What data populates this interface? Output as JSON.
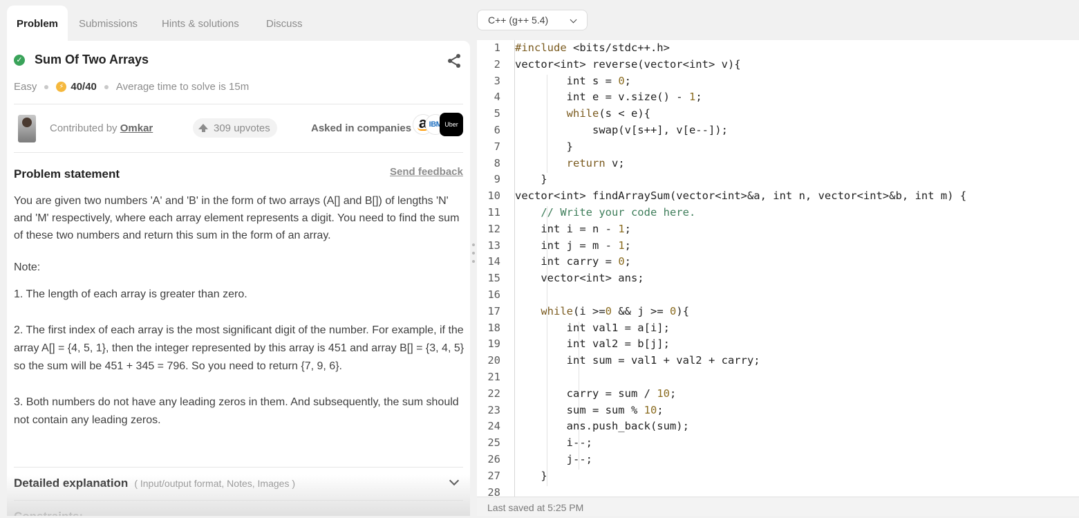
{
  "tabs": [
    {
      "label": "Problem",
      "active": true
    },
    {
      "label": "Submissions",
      "active": false
    },
    {
      "label": "Hints & solutions",
      "active": false
    },
    {
      "label": "Discuss",
      "active": false
    }
  ],
  "problem": {
    "title": "Sum Of Two Arrays",
    "difficulty": "Easy",
    "score": "40/40",
    "avg_time": "Average time to solve is 15m",
    "contributed_by_label": "Contributed by",
    "contributor": "Omkar",
    "upvotes": "309 upvotes",
    "asked_label": "Asked in companies",
    "companies": [
      {
        "name": "amazon-logo",
        "glyph": "a"
      },
      {
        "name": "ibm-logo",
        "glyph": "IBM"
      },
      {
        "name": "uber-logo",
        "glyph": "Uber"
      }
    ],
    "statement_heading": "Problem statement",
    "feedback_label": "Send feedback",
    "statement": "You are given two numbers 'A' and 'B' in the form of two arrays (A[] and B[]) of lengths 'N' and 'M' respectively, where each array element represents a digit. You need to find the sum of these two numbers and return this sum in the form of an array.",
    "note": "Note:",
    "points": [
      "1. The length of each array is greater than zero.",
      "2. The first index of each array is the most significant digit of the number. For example, if the array A[] = {4, 5, 1}, then the integer represented by this array is 451 and array B[] = {3, 4, 5} so the sum will be 451 + 345 = 796. So you need to return {7, 9, 6}.",
      "3. Both numbers do not have any leading zeros in them. And subsequently, the sum should not contain any leading zeros."
    ],
    "detail_title": "Detailed explanation",
    "detail_sub": "( Input/output format, Notes, Images )",
    "constraints_label": "Constraints:"
  },
  "editor": {
    "language": "C++ (g++ 5.4)",
    "last_saved": "Last saved at 5:25 PM",
    "lines": [
      "#include <bits/stdc++.h>",
      "vector<int> reverse(vector<int> v){",
      "        int s = 0;",
      "        int e = v.size() - 1;",
      "        while(s < e){",
      "            swap(v[s++], v[e--]);",
      "        }",
      "        return v;",
      "    }",
      "vector<int> findArraySum(vector<int>&a, int n, vector<int>&b, int m) {",
      "    // Write your code here.",
      "    int i = n - 1;",
      "    int j = m - 1;",
      "    int carry = 0;",
      "    vector<int> ans;",
      "",
      "    while(i >=0 && j >= 0){",
      "        int val1 = a[i];",
      "        int val2 = b[j];",
      "        int sum = val1 + val2 + carry;",
      "",
      "        carry = sum / 10;",
      "        sum = sum % 10;",
      "        ans.push_back(sum);",
      "        i--;",
      "        j--;",
      "    }",
      ""
    ]
  },
  "colors": {
    "keyword": "#7a5a1e",
    "number": "#8a6b1f",
    "comment": "#3e7d5a",
    "success": "#3aa35a",
    "bolt": "#f5b83d"
  }
}
